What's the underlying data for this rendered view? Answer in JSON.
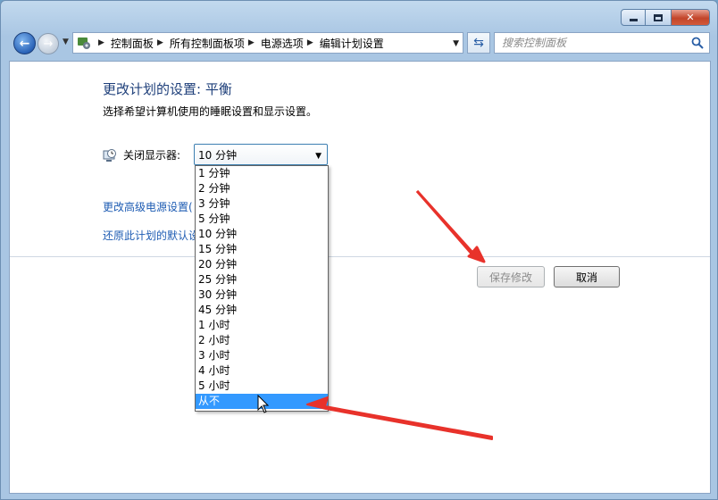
{
  "window": {
    "caption": {
      "minimize": "min",
      "maximize": "max",
      "close": "✕"
    }
  },
  "navbar": {
    "breadcrumbs": [
      "控制面板",
      "所有控制面板项",
      "电源选项",
      "编辑计划设置"
    ],
    "search_placeholder": "搜索控制面板"
  },
  "content": {
    "heading": "更改计划的设置: 平衡",
    "subtext": "选择希望计算机使用的睡眠设置和显示设置。",
    "display_label": "关闭显示器:",
    "display_value": "10 分钟",
    "advanced_link": "更改高级电源设置(",
    "restore_link": "还原此计划的默认设",
    "save_button": "保存修改",
    "cancel_button": "取消"
  },
  "dropdown": {
    "options": [
      "1 分钟",
      "2 分钟",
      "3 分钟",
      "5 分钟",
      "10 分钟",
      "15 分钟",
      "20 分钟",
      "25 分钟",
      "30 分钟",
      "45 分钟",
      "1 小时",
      "2 小时",
      "3 小时",
      "4 小时",
      "5 小时",
      "从不"
    ],
    "highlighted_index": 15
  },
  "colors": {
    "heading": "#1e3f7a",
    "link": "#1e5cb3",
    "selection": "#3399ff",
    "annotation_arrow": "#e8322b"
  }
}
